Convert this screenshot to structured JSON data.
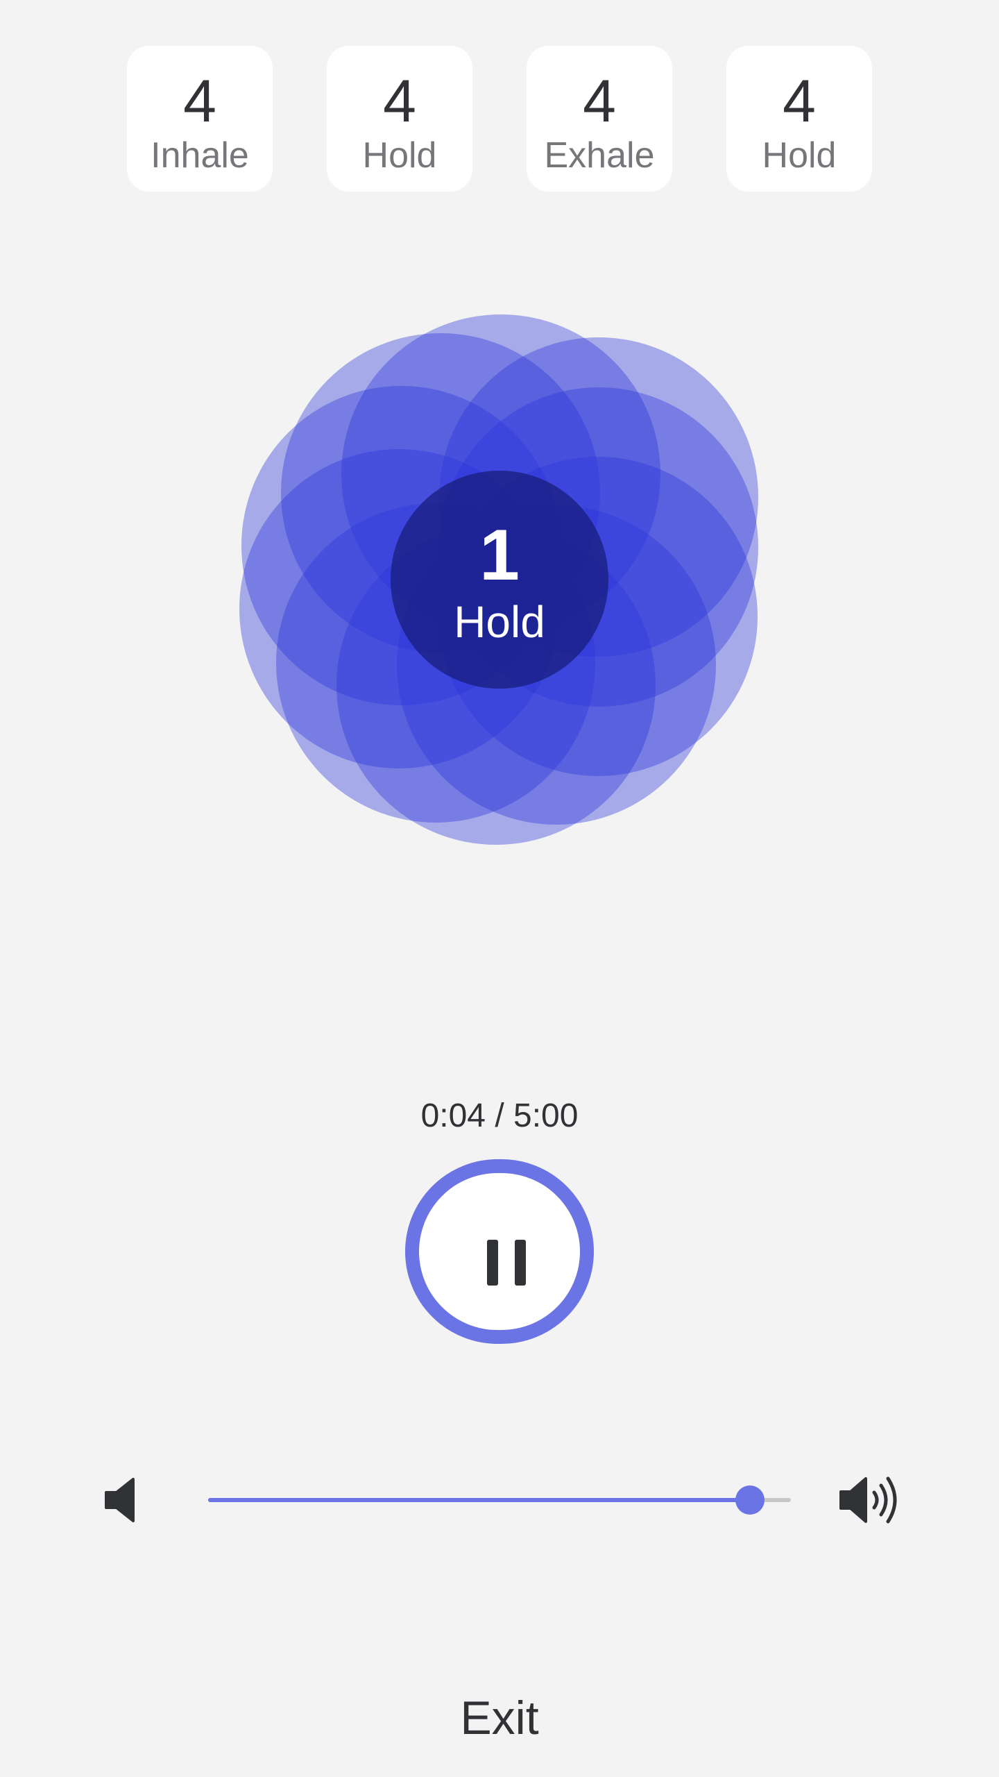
{
  "phases": [
    {
      "count": "4",
      "label": "Inhale"
    },
    {
      "count": "4",
      "label": "Hold"
    },
    {
      "count": "4",
      "label": "Exhale"
    },
    {
      "count": "4",
      "label": "Hold"
    }
  ],
  "breath": {
    "count": "1",
    "phase": "Hold"
  },
  "timer": {
    "text": "0:04 / 5:00"
  },
  "controls": {
    "pause_icon": "pause-icon"
  },
  "volume": {
    "level": 0.93,
    "mute_icon": "volume-low-icon",
    "max_icon": "volume-high-icon"
  },
  "exit": {
    "label": "Exit"
  },
  "colors": {
    "accent": "#6b74e4",
    "petal": "#2b35d9",
    "core": "#1a1f80",
    "background": "#f3f3f3"
  }
}
